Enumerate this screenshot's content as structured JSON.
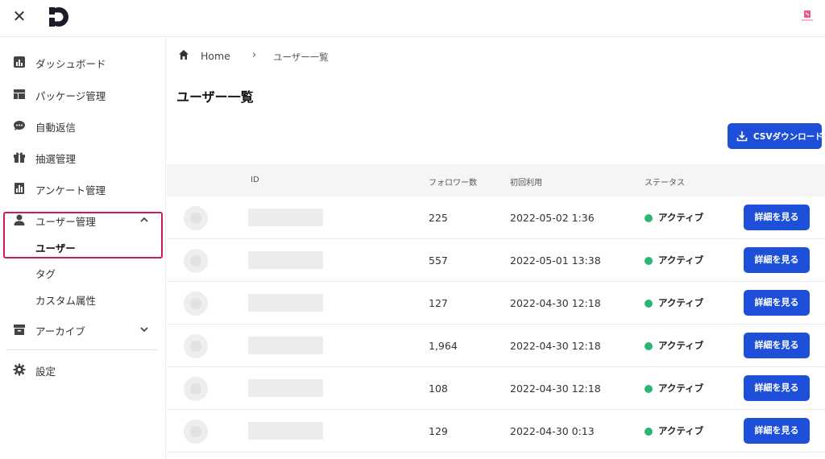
{
  "app": {
    "close_label": "✕"
  },
  "sidebar": {
    "items": [
      {
        "label": "ダッシュボード",
        "icon": "bar-chart-icon"
      },
      {
        "label": "パッケージ管理",
        "icon": "layout-icon"
      },
      {
        "label": "自動返信",
        "icon": "chat-bubble-icon"
      },
      {
        "label": "抽選管理",
        "icon": "gift-icon"
      },
      {
        "label": "アンケート管理",
        "icon": "poll-icon"
      },
      {
        "label": "ユーザー管理",
        "icon": "person-icon",
        "expanded": true
      },
      {
        "label": "アーカイブ",
        "icon": "archive-icon"
      },
      {
        "label": "設定",
        "icon": "gear-icon"
      }
    ],
    "user_sub_items": [
      {
        "label": "ユーザー",
        "active": true
      },
      {
        "label": "タグ"
      },
      {
        "label": "カスタム属性"
      }
    ]
  },
  "breadcrumb": {
    "home": "Home",
    "separator": "›",
    "current": "ユーザー一覧"
  },
  "page": {
    "title": "ユーザー一覧",
    "csv_button": "CSVダウンロード"
  },
  "table": {
    "columns": [
      "ID",
      "フォロワー数",
      "初回利用",
      "ステータス"
    ],
    "rows": [
      {
        "followers": "225",
        "first_use": "2022-05-02 1:36",
        "status": "アクティブ",
        "action": "詳細を見る"
      },
      {
        "followers": "557",
        "first_use": "2022-05-01 13:38",
        "status": "アクティブ",
        "action": "詳細を見る"
      },
      {
        "followers": "127",
        "first_use": "2022-04-30 12:18",
        "status": "アクティブ",
        "action": "詳細を見る"
      },
      {
        "followers": "1,964",
        "first_use": "2022-04-30 12:18",
        "status": "アクティブ",
        "action": "詳細を見る"
      },
      {
        "followers": "108",
        "first_use": "2022-04-30 12:18",
        "status": "アクティブ",
        "action": "詳細を見る"
      },
      {
        "followers": "129",
        "first_use": "2022-04-30 0:13",
        "status": "アクティブ",
        "action": "詳細を見る"
      }
    ]
  },
  "colors": {
    "primary": "#1e4fd8",
    "status_active": "#2bb673",
    "highlight": "#d2175b"
  }
}
